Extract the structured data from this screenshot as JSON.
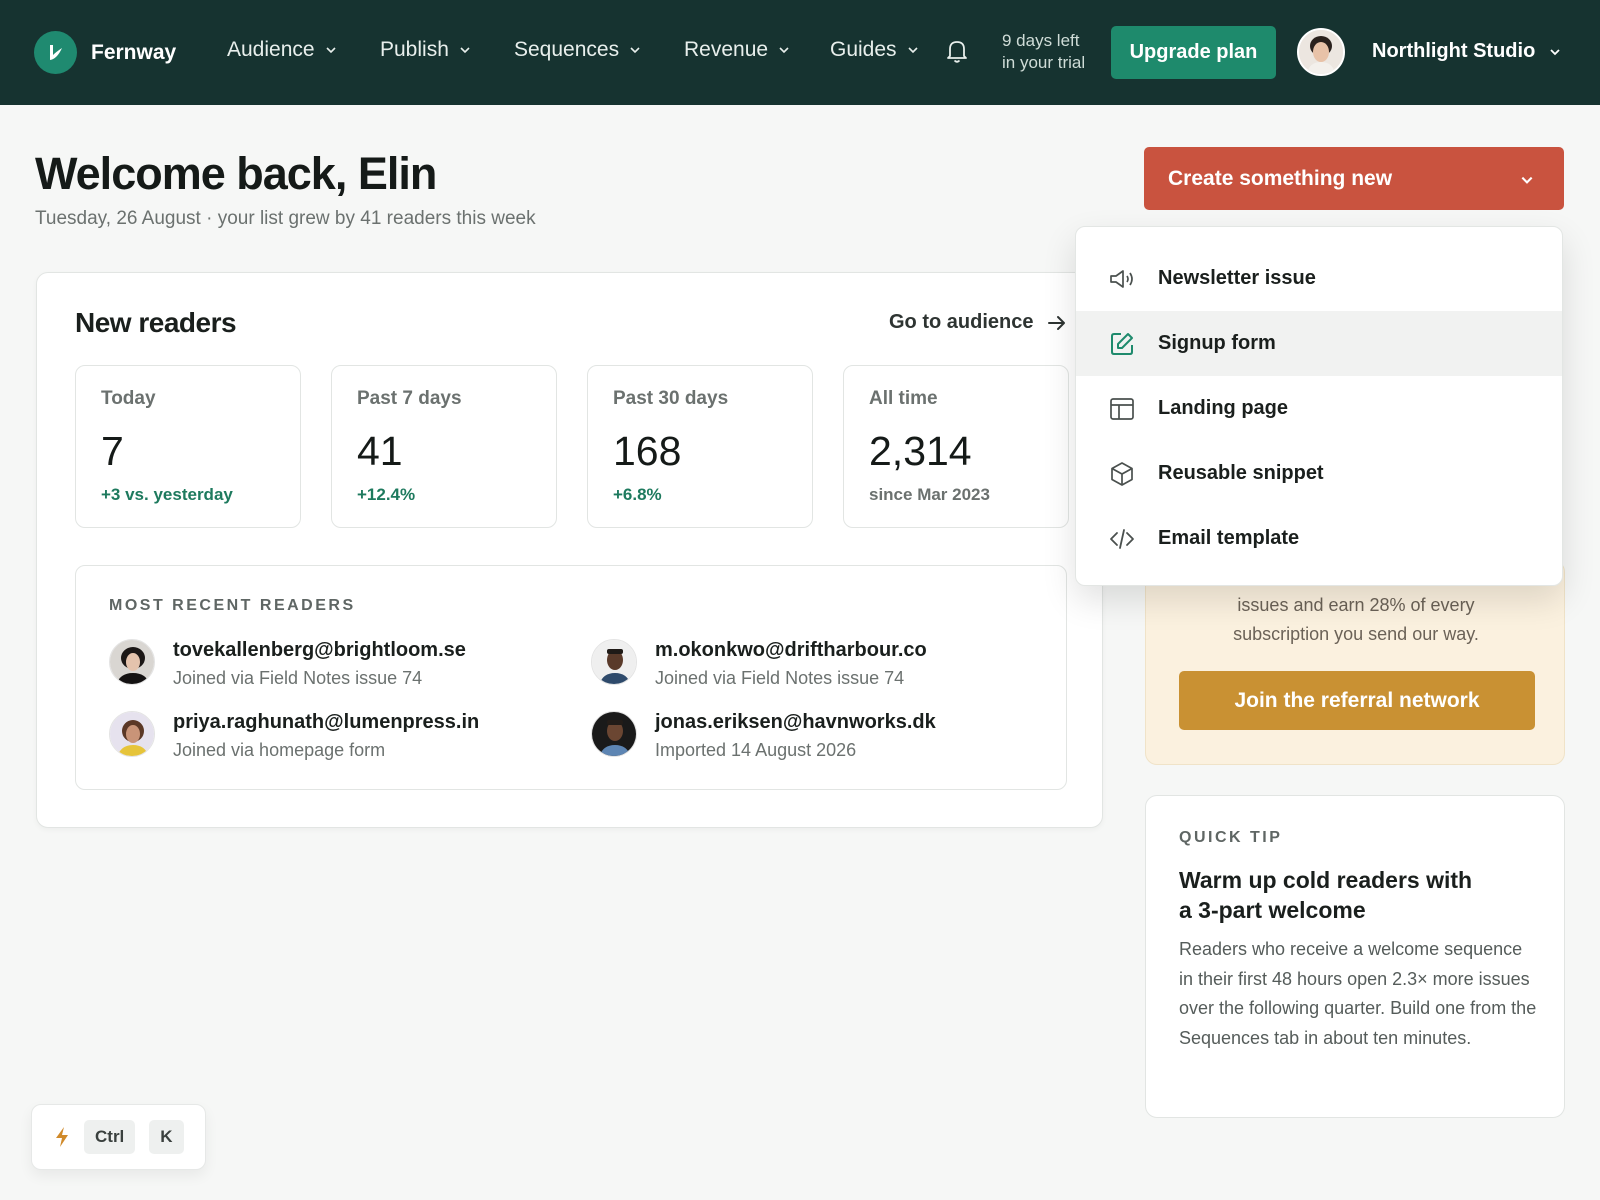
{
  "nav": {
    "brand": "Fernway",
    "items": [
      {
        "label": "Audience"
      },
      {
        "label": "Publish"
      },
      {
        "label": "Sequences"
      },
      {
        "label": "Revenue"
      },
      {
        "label": "Guides"
      }
    ],
    "trial_line1": "9 days left",
    "trial_line2": "in your trial",
    "upgrade": "Upgrade plan",
    "workspace": "Northlight Studio"
  },
  "header": {
    "title": "Welcome back, Elin",
    "subtitle": "Tuesday, 26 August · your list grew by 41 readers this week"
  },
  "create": {
    "label": "Create something new",
    "menu": [
      {
        "label": "Newsletter issue",
        "icon": "megaphone-icon"
      },
      {
        "label": "Signup form",
        "icon": "edit-form-icon",
        "active": true
      },
      {
        "label": "Landing page",
        "icon": "layout-icon"
      },
      {
        "label": "Reusable snippet",
        "icon": "cube-icon"
      },
      {
        "label": "Email template",
        "icon": "code-icon"
      }
    ]
  },
  "readers": {
    "title": "New readers",
    "goto": "Go to audience",
    "stats": [
      {
        "label": "Today",
        "value": "7",
        "delta": "+3 vs. yesterday"
      },
      {
        "label": "Past 7 days",
        "value": "41",
        "delta": "+12.4%"
      },
      {
        "label": "Past 30 days",
        "value": "168",
        "delta": "+6.8%"
      },
      {
        "label": "All time",
        "value": "2,314",
        "delta": "since Mar 2023"
      }
    ],
    "recent_title": "MOST RECENT READERS",
    "recent": [
      {
        "email": "tovekallenberg@brightloom.se",
        "joined": "Joined via Field Notes issue 74"
      },
      {
        "email": "m.okonkwo@driftharbour.co",
        "joined": "Joined via Field Notes issue 74"
      },
      {
        "email": "priya.raghunath@lumenpress.in",
        "joined": "Joined via homepage form"
      },
      {
        "email": "jonas.eriksen@havnworks.dk",
        "joined": "Imported 14 August 2026"
      }
    ]
  },
  "referral": {
    "text_line1": "issues and earn 28% of every",
    "text_line2": "subscription you send our way.",
    "button": "Join the referral network"
  },
  "tip": {
    "eyebrow": "QUICK TIP",
    "title": "Warm up cold readers with a 3-part welcome",
    "body": "Readers who receive a welcome sequence in their first 48 hours open 2.3× more issues over the following quarter. Build one from the Sequences tab in about ten minutes."
  },
  "cmdbar": {
    "key1": "Ctrl",
    "key2": "K"
  },
  "colors": {
    "nav_bg": "#163330",
    "accent": "#1e8a6c",
    "create": "#c9533f",
    "referral_button": "#c99133"
  }
}
